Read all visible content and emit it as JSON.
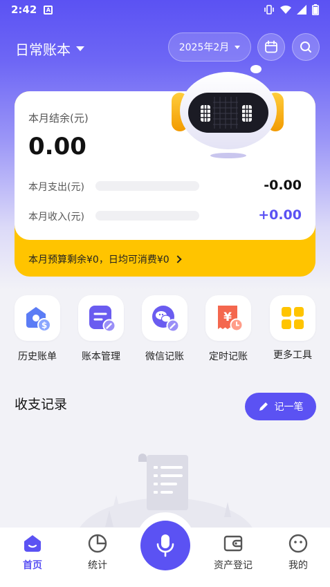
{
  "status_bar": {
    "time": "2:42",
    "notification_icon": "A"
  },
  "header": {
    "book_name": "日常账本",
    "month": "2025年2月",
    "calendar_icon": "calendar-icon",
    "search_icon": "search-icon"
  },
  "summary": {
    "balance_label": "本月结余(元)",
    "balance_value": "0.00",
    "expense_label": "本月支出(元)",
    "expense_value": "-0.00",
    "income_label": "本月收入(元)",
    "income_value": "+0.00",
    "budget_text": "本月预算剩余¥0，日均可消费¥0"
  },
  "tools": [
    {
      "label": "历史账单",
      "icon": "history-bill-icon"
    },
    {
      "label": "账本管理",
      "icon": "book-manage-icon"
    },
    {
      "label": "微信记账",
      "icon": "wechat-record-icon"
    },
    {
      "label": "定时记账",
      "icon": "scheduled-record-icon"
    },
    {
      "label": "更多工具",
      "icon": "more-tools-icon"
    }
  ],
  "records": {
    "title": "收支记录",
    "add_button": "记一笔"
  },
  "nav": {
    "home": "首页",
    "stats": "统计",
    "assets": "资产登记",
    "mine": "我的"
  },
  "colors": {
    "primary": "#5b52f3",
    "yellow": "#ffc400",
    "income": "#5b52f3",
    "expense": "#111111"
  }
}
